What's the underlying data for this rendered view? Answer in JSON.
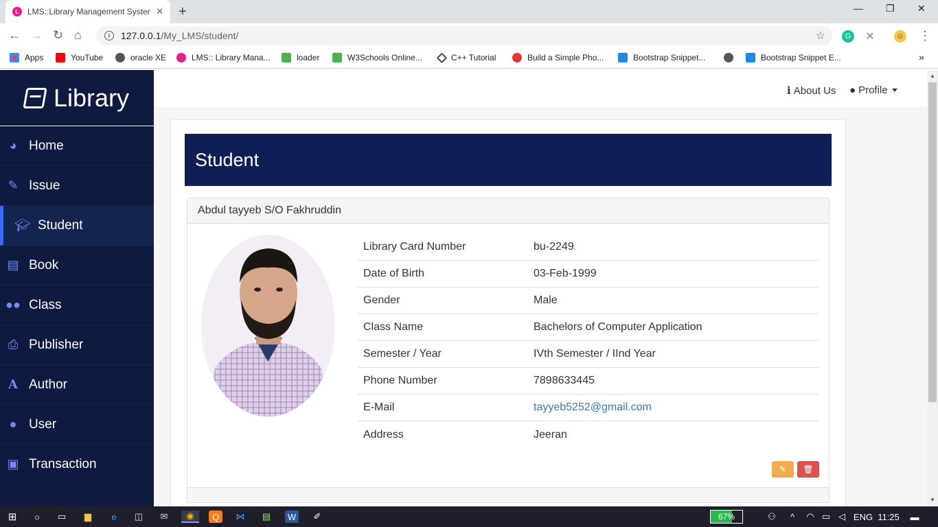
{
  "browser": {
    "tab_title": "LMS::Library Management System",
    "url_host": "127.0.0.1",
    "url_path": "/My_LMS/student/",
    "bookmarks": [
      {
        "label": "Apps",
        "color": "#ea4335"
      },
      {
        "label": "YouTube",
        "color": "#ff0000"
      },
      {
        "label": "oracle XE",
        "color": "#555555"
      },
      {
        "label": "LMS:: Library Mana...",
        "color": "#e91e8c"
      },
      {
        "label": "loader",
        "color": "#4caf50"
      },
      {
        "label": "W3Schools Online...",
        "color": "#4caf50"
      },
      {
        "label": "C++ Tutorial",
        "color": "#444444"
      },
      {
        "label": "Build a Simple Pho...",
        "color": "#e53935"
      },
      {
        "label": "Bootstrap Snippet...",
        "color": "#1e88e5"
      },
      {
        "label": "",
        "color": "#555555"
      },
      {
        "label": "Bootstrap Snippet E...",
        "color": "#1e88e5"
      }
    ]
  },
  "sidebar": {
    "brand": "Library",
    "items": [
      {
        "label": "Home",
        "icon": "dashboard-icon"
      },
      {
        "label": "Issue",
        "icon": "edit-icon"
      },
      {
        "label": "Student",
        "icon": "graduation-cap-icon",
        "active": true
      },
      {
        "label": "Book",
        "icon": "book-icon"
      },
      {
        "label": "Class",
        "icon": "users-icon"
      },
      {
        "label": "Publisher",
        "icon": "print-icon"
      },
      {
        "label": "Author",
        "icon": "font-icon"
      },
      {
        "label": "User",
        "icon": "user-icon"
      },
      {
        "label": "Transaction",
        "icon": "money-icon"
      }
    ]
  },
  "topnav": {
    "about": "About Us",
    "profile": "Profile"
  },
  "page": {
    "title": "Student",
    "student_name": "Abdul tayyeb S/O Fakhruddin",
    "details": [
      {
        "key": "Library Card Number",
        "value": "bu-2249"
      },
      {
        "key": "Date of Birth",
        "value": "03-Feb-1999"
      },
      {
        "key": "Gender",
        "value": "Male"
      },
      {
        "key": "Class Name",
        "value": "Bachelors of Computer Application"
      },
      {
        "key": "Semester / Year",
        "value": "IVth Semester / IInd Year"
      },
      {
        "key": "Phone Number",
        "value": "7898633445"
      },
      {
        "key": "E-Mail",
        "value": "tayyeb5252@gmail.com"
      },
      {
        "key": "Address",
        "value": "Jeeran"
      }
    ]
  },
  "taskbar": {
    "battery": "67%",
    "language": "ENG",
    "time": "11:25"
  }
}
